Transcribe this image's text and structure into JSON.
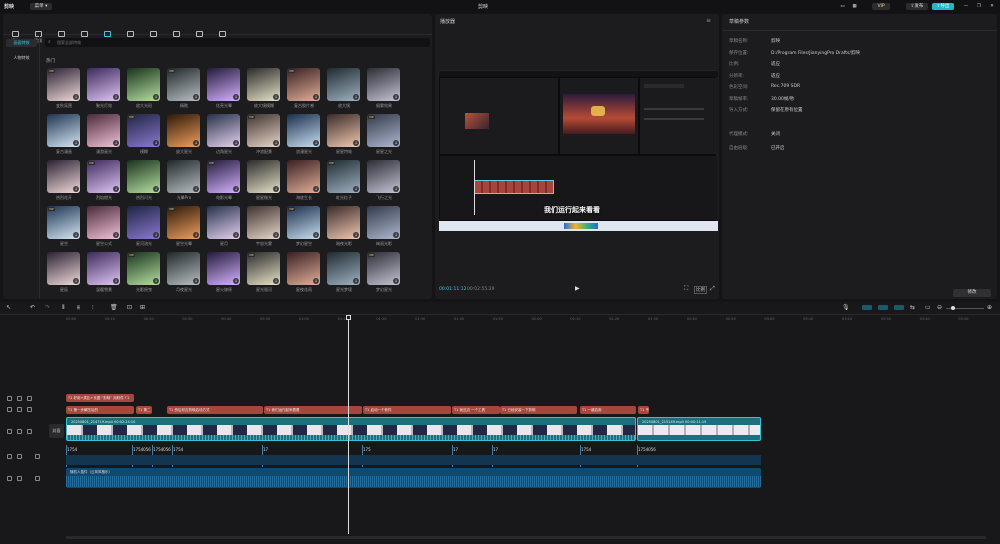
{
  "app": {
    "name": "剪映",
    "menu_label": "菜单",
    "project_title": "剪映",
    "vip": "VIP",
    "publish": "发布",
    "export": "导出"
  },
  "toolbar": [
    {
      "label": "媒体"
    },
    {
      "label": "音频"
    },
    {
      "label": "文本"
    },
    {
      "label": "贴纸"
    },
    {
      "label": "特效"
    },
    {
      "label": "转场"
    },
    {
      "label": "字幕"
    },
    {
      "label": "滤镜"
    },
    {
      "label": "调节"
    },
    {
      "label": "模板"
    }
  ],
  "effects": {
    "sidebar": [
      "画面特效",
      "人物特效"
    ],
    "search_placeholder": "搜索全部特效",
    "section": "热门",
    "grid": [
      [
        "变秋氛围",
        "聚光灯效",
        "放大光斑",
        "精眩",
        "炫亮光晕",
        "放大镜模糊",
        "复古胶片感",
        "放大镜",
        "烟雾效果"
      ],
      [
        "复古漫画",
        "漫游画光",
        "模糊",
        "放大星光",
        "边角星光",
        "冲浪配景",
        "浪漫星光",
        "星星特效",
        "星星之光"
      ],
      [
        "热烈花开",
        "烈焰燃光",
        "热烈闪光",
        "光晕Pro",
        "电影光晕",
        "星星微光",
        "海底生长",
        "虹光粒子",
        "飞行之光"
      ],
      [
        "星空",
        "星空公式",
        "星河流光",
        "星空光晕",
        "星月",
        "宇宙光雾",
        "梦幻星空",
        "暗夜光影",
        "绚丽光影"
      ],
      [
        "星辰",
        "温暖雪景",
        "光影摇曳",
        "月夜星光",
        "星火燎原",
        "星光银河",
        "星夜花雨",
        "星光梦境",
        "梦幻星光"
      ]
    ]
  },
  "player": {
    "title": "播放器",
    "current_time": "00:01:11:12",
    "total_time": "00:02:55:29",
    "ratio_label": "比例",
    "caption": "我们运行起来看看"
  },
  "props": {
    "title": "草稿参数",
    "rows": [
      [
        "草稿名称:",
        "剪映"
      ],
      [
        "保存位置:",
        "D:/Program Files/JianyingPro Drafts/剪映"
      ],
      [
        "比例:",
        "适应"
      ],
      [
        "分辨率:",
        "适应"
      ],
      [
        "色彩空间:",
        "Rec.709 SDR"
      ],
      [
        "草稿帧率:",
        "30.00帧/秒"
      ],
      [
        "导入方式:",
        "保留在原有位置"
      ]
    ],
    "rows2": [
      [
        "代理模式:",
        "关闭"
      ],
      [
        "自由层级:",
        "已开启"
      ]
    ],
    "edit_btn": "修改"
  },
  "timeline": {
    "ruler": [
      "00:00",
      "00:10",
      "00:20",
      "00:30",
      "00:40",
      "00:50",
      "01:00",
      "01:10",
      "01:20",
      "01:30",
      "01:40",
      "01:50",
      "02:00",
      "02:10",
      "02:20",
      "02:30",
      "02:40",
      "02:50",
      "03:00",
      "03:10",
      "03:20",
      "03:30",
      "03:40",
      "03:50"
    ],
    "text_track1": [
      {
        "label": "好用+类比+长图 “剪映” 用软件 T1"
      }
    ],
    "text_track2": [
      {
        "label": "第一步解压后的"
      },
      {
        "label": "第二"
      },
      {
        "label": "然后双击剪映启动方式"
      },
      {
        "label": "我们运行起来看看"
      },
      {
        "label": "启动一个软件"
      },
      {
        "label": "我这边 一个工具"
      },
      {
        "label": "已经安装一下剪映"
      },
      {
        "label": "一键启用"
      },
      {
        "label": "不敢被插件了 没有剪映 先成功"
      }
    ],
    "cover": "封面",
    "video_clips": [
      {
        "label": "20250801_214719.mp4  00:02:24:10"
      },
      {
        "label": "20250801_215149.mp4  00:00:11:19"
      }
    ],
    "audio_marks": [
      "1754",
      "1754056",
      "1754056",
      "1754",
      "17",
      "175",
      "17",
      "17",
      "1754",
      "1754056"
    ],
    "music": {
      "label": "随机人插件（云风风格乐）"
    }
  },
  "colors": {
    "accent": "#3fc8e0",
    "text_clip": "#a8453d",
    "video_clip": "#1c6f7c",
    "audio_clip": "#0e4a6e"
  }
}
